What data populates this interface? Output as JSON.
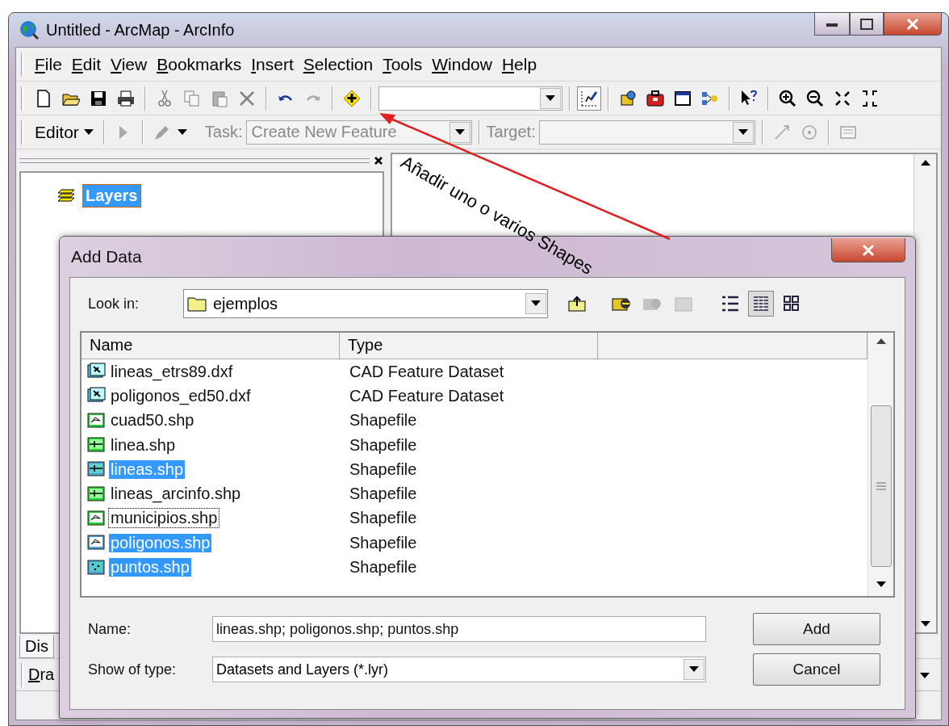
{
  "window": {
    "title": "Untitled - ArcMap - ArcInfo"
  },
  "menu": [
    {
      "label": "File"
    },
    {
      "label": "Edit"
    },
    {
      "label": "View"
    },
    {
      "label": "Bookmarks"
    },
    {
      "label": "Insert"
    },
    {
      "label": "Selection"
    },
    {
      "label": "Tools"
    },
    {
      "label": "Window"
    },
    {
      "label": "Help"
    }
  ],
  "editor_toolbar": {
    "editor": "Editor",
    "task": {
      "label": "Task:",
      "value": "Create New Feature",
      "disabled": true
    },
    "target": {
      "label": "Target:",
      "disabled": true
    }
  },
  "toc": {
    "root": {
      "label": "Layers",
      "selected": true
    },
    "tab": "Dis"
  },
  "drawing_toolbar": {
    "label": "Dra"
  },
  "annotation": {
    "text": "Añadir uno o varios Shapes"
  },
  "dialog": {
    "title": "Add Data",
    "look_in": {
      "label": "Look in:",
      "value": "ejemplos"
    },
    "view_buttons": [
      {
        "selected": false
      },
      {
        "selected": true
      },
      {
        "selected": false
      }
    ],
    "columns": [
      "Name",
      "Type"
    ],
    "rows": [
      {
        "name": "lineas_etrs89.dxf",
        "type": "CAD Feature Dataset",
        "kind": "cad",
        "selected": false,
        "focused": false
      },
      {
        "name": "poligonos_ed50.dxf",
        "type": "CAD Feature Dataset",
        "kind": "cad",
        "selected": false,
        "focused": false
      },
      {
        "name": "cuad50.shp",
        "type": "Shapefile",
        "kind": "polygon",
        "selected": false,
        "focused": false
      },
      {
        "name": "linea.shp",
        "type": "Shapefile",
        "kind": "line",
        "selected": false,
        "focused": false
      },
      {
        "name": "lineas.shp",
        "type": "Shapefile",
        "kind": "line",
        "selected": true,
        "focused": false
      },
      {
        "name": "lineas_arcinfo.shp",
        "type": "Shapefile",
        "kind": "line",
        "selected": false,
        "focused": false
      },
      {
        "name": "municipios.shp",
        "type": "Shapefile",
        "kind": "polygon",
        "selected": false,
        "focused": true
      },
      {
        "name": "poligonos.shp",
        "type": "Shapefile",
        "kind": "polygon",
        "selected": true,
        "focused": false
      },
      {
        "name": "puntos.shp",
        "type": "Shapefile",
        "kind": "point",
        "selected": true,
        "focused": false
      }
    ],
    "name_field": {
      "label": "Name:",
      "value": "lineas.shp; poligonos.shp; puntos.shp"
    },
    "type_field": {
      "label": "Show of type:",
      "value": "Datasets and Layers (*.lyr)"
    },
    "buttons": [
      "Add",
      "Cancel"
    ]
  }
}
